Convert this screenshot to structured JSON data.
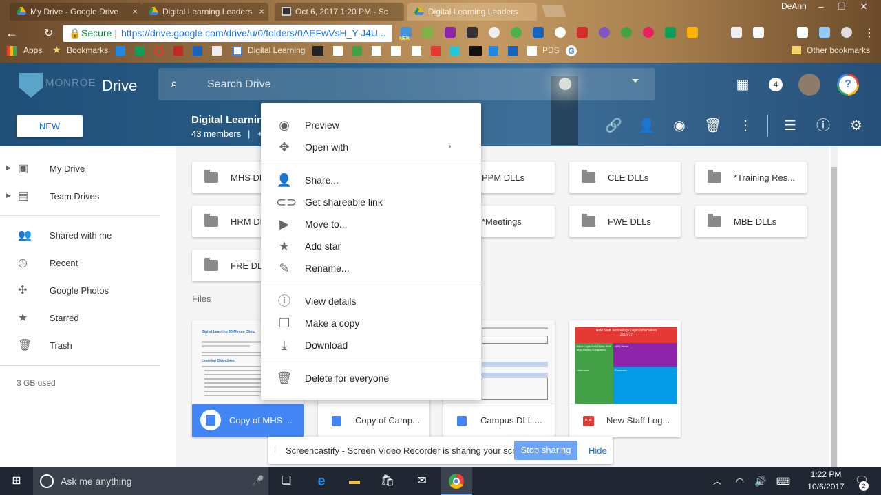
{
  "browser": {
    "tabs": [
      {
        "label": "My Drive - Google Drive",
        "active": false
      },
      {
        "label": "Digital Learning Leaders",
        "active": false
      },
      {
        "label": "Oct 6, 2017 1:20 PM - Sc",
        "active": false
      },
      {
        "label": "Digital Learning Leaders",
        "active": true
      }
    ],
    "user": "DeAnn",
    "secure_label": "Secure",
    "url": "https://drive.google.com/drive/u/0/folders/0AEFwVsH_Y-J4U...",
    "new_badge": "NEW",
    "bookmarks": {
      "apps": "Apps",
      "bookmarks": "Bookmarks",
      "digital_learning": "Digital Learning",
      "pds": "PDS",
      "other": "Other bookmarks"
    }
  },
  "drive": {
    "logo_text": "MONROE",
    "product": "Drive",
    "search_placeholder": "Search Drive",
    "notifications_count": "4",
    "new_button": "NEW",
    "team_drive_title": "Digital Learning",
    "members": "43 members",
    "members_sep": "|",
    "members_plus": "+"
  },
  "sidebar": {
    "items": [
      {
        "label": "My Drive",
        "icon": "my-drive-icon"
      },
      {
        "label": "Team Drives",
        "icon": "team-drives-icon"
      },
      {
        "label": "Shared with me",
        "icon": "people-icon"
      },
      {
        "label": "Recent",
        "icon": "clock-icon"
      },
      {
        "label": "Google Photos",
        "icon": "pinwheel-icon"
      },
      {
        "label": "Starred",
        "icon": "star-icon"
      },
      {
        "label": "Trash",
        "icon": "trash-icon"
      }
    ],
    "storage": "3 GB used"
  },
  "folders": [
    {
      "label": "MHS DL"
    },
    {
      "label": "PPM DLLs"
    },
    {
      "label": "CLE DLLs"
    },
    {
      "label": "*Training Res..."
    },
    {
      "label": "HRM DL"
    },
    {
      "label": "*Meetings"
    },
    {
      "label": "FWE DLLs"
    },
    {
      "label": "MBE DLLs"
    },
    {
      "label": "FRE DLL"
    }
  ],
  "files_heading": "Files",
  "files": [
    {
      "label": "Copy of MHS ...",
      "type": "doc",
      "thumb_title": "Digital Learning 30-Minute Clinic",
      "thumb_sub": "Learning Objectives"
    },
    {
      "label": "Copy of Camp...",
      "type": "doc"
    },
    {
      "label": "Campus DLL ...",
      "type": "doc"
    },
    {
      "label": "New Staff Log...",
      "type": "pdf",
      "badge": "PDF",
      "thumb_title": "New Staff Technology Login Information",
      "thumb_year": "2016-17",
      "thumb_cells": [
        "Initial Login for All New Staff onto District Computers",
        "HPS Portal",
        "Username",
        "Password"
      ]
    }
  ],
  "context_menu": {
    "groups": [
      [
        {
          "label": "Preview",
          "icon": "eye-icon"
        },
        {
          "label": "Open with",
          "icon": "move-arrows-icon",
          "submenu": true
        }
      ],
      [
        {
          "label": "Share...",
          "icon": "add-person-icon"
        },
        {
          "label": "Get shareable link",
          "icon": "link-icon"
        },
        {
          "label": "Move to...",
          "icon": "folder-move-icon"
        },
        {
          "label": "Add star",
          "icon": "star-icon"
        },
        {
          "label": "Rename...",
          "icon": "pencil-icon"
        }
      ],
      [
        {
          "label": "View details",
          "icon": "info-icon"
        },
        {
          "label": "Make a copy",
          "icon": "copy-icon"
        },
        {
          "label": "Download",
          "icon": "download-icon"
        }
      ],
      [
        {
          "label": "Delete for everyone",
          "icon": "trash-icon"
        }
      ]
    ]
  },
  "screencast": {
    "message": "Screencastify - Screen Video Recorder is sharing your screen.",
    "stop": "Stop sharing",
    "hide": "Hide"
  },
  "taskbar": {
    "search_placeholder": "Ask me anything",
    "time": "1:22 PM",
    "date": "10/6/2017",
    "notif_count": "2"
  },
  "colors": {
    "drive_blue": "#1a73e8",
    "selected": "#4285f4",
    "stop_btn": "#6ea4f5"
  }
}
